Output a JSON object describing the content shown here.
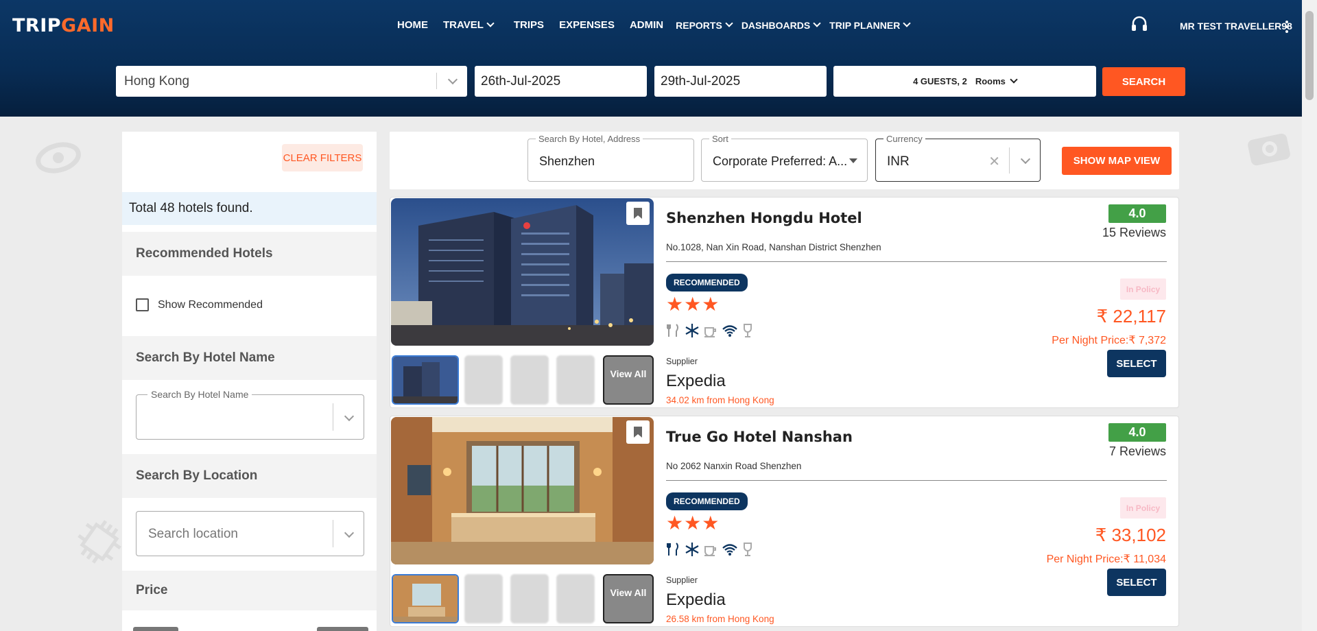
{
  "brand": {
    "logo_left": "TRIP",
    "logo_right": "GAIN"
  },
  "nav": [
    {
      "label": "HOME",
      "dropdown": false
    },
    {
      "label": "TRAVEL",
      "dropdown": true
    },
    {
      "label": "TRIPS",
      "dropdown": false
    },
    {
      "label": "EXPENSES",
      "dropdown": false
    },
    {
      "label": "ADMIN",
      "dropdown": false
    },
    {
      "label": "REPORTS",
      "dropdown": true
    },
    {
      "label": "DASHBOARDS",
      "dropdown": true
    },
    {
      "label": "TRIP PLANNER",
      "dropdown": true
    }
  ],
  "user": {
    "name": "MR TEST TRAVELLER98"
  },
  "search": {
    "city": "Hong Kong",
    "checkin": "26th-Jul-2025",
    "checkout": "29th-Jul-2025",
    "guests": "4 GUESTS, 2",
    "rooms": "Rooms",
    "button": "SEARCH"
  },
  "sidebar": {
    "clear_filters": "CLEAR FILTERS",
    "total": "Total 48 hotels found.",
    "recommended_title": "Recommended Hotels",
    "show_recommended": "Show Recommended",
    "hotel_name_title": "Search By Hotel Name",
    "hotel_name_legend": "Search By Hotel Name",
    "location_title": "Search By Location",
    "location_placeholder": "Search location",
    "price_title": "Price"
  },
  "toolbar": {
    "hotel_legend": "Search By Hotel, Address",
    "hotel_value": "Shenzhen",
    "sort_legend": "Sort",
    "sort_value": "Corporate Preferred: A...",
    "currency_legend": "Currency",
    "currency_value": "INR",
    "map_button": "SHOW MAP VIEW"
  },
  "hotels": [
    {
      "name": "Shenzhen Hongdu Hotel",
      "address": "No.1028, Nan Xin Road, Nanshan District Shenzhen",
      "rating": "4.0",
      "reviews": "15 Reviews",
      "badge": "RECOMMENDED",
      "stars": 3,
      "policy": "In Policy",
      "price": "₹ 22,117",
      "per_night": "Per Night Price:₹ 7,372",
      "select": "SELECT",
      "supplier_label": "Supplier",
      "supplier": "Expedia",
      "distance": "34.02 km from Hong Kong",
      "view_all": "View All"
    },
    {
      "name": "True Go Hotel Nanshan",
      "address": "No 2062 Nanxin Road Shenzhen",
      "rating": "4.0",
      "reviews": "7 Reviews",
      "badge": "RECOMMENDED",
      "stars": 3,
      "policy": "In Policy",
      "price": "₹ 33,102",
      "per_night": "Per Night Price:₹ 11,034",
      "select": "SELECT",
      "supplier_label": "Supplier",
      "supplier": "Expedia",
      "distance": "26.58 km from Hong Kong",
      "view_all": "View All"
    }
  ],
  "icons": {
    "support": "headset-icon",
    "menu": "kebab-menu-icon",
    "bookmark": "bookmark-icon",
    "amenities": [
      "restaurant-icon",
      "snowflake-ac-icon",
      "coffee-cup-icon",
      "wifi-icon",
      "wine-glass-icon"
    ]
  },
  "colors": {
    "brand_navy": "#0c3766",
    "accent_orange": "#ff5722",
    "rating_green": "#43a047",
    "badge_navy": "#0d3560"
  }
}
